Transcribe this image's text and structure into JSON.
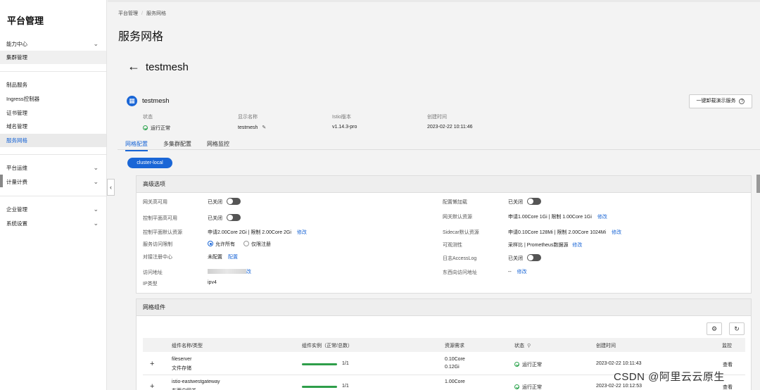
{
  "sidebar": {
    "title": "平台管理",
    "items": [
      {
        "label": "能力中心",
        "expandable": true
      },
      {
        "label": "集群管理",
        "expandable": false
      },
      {
        "label": "制品服务",
        "expandable": false
      },
      {
        "label": "Ingress控制器",
        "expandable": false
      },
      {
        "label": "证书管理",
        "expandable": false
      },
      {
        "label": "域名管理",
        "expandable": false
      },
      {
        "label": "服务网格",
        "expandable": false,
        "active": true
      },
      {
        "label": "平台运维",
        "expandable": true
      },
      {
        "label": "计量计费",
        "expandable": true
      },
      {
        "label": "企业管理",
        "expandable": true
      },
      {
        "label": "系统设置",
        "expandable": true
      }
    ],
    "collapse_icon": "chevron-left-icon"
  },
  "breadcrumb": [
    "平台管理",
    "服务网格"
  ],
  "page_title": "服务网格",
  "mesh": {
    "title": "testmesh",
    "name": "testmesh",
    "uninstall_button": "一键卸载演示服务",
    "info": {
      "status_label": "状态",
      "status_value": "运行正常",
      "display_name_label": "显示名称",
      "display_name_value": "testmesh",
      "istio_label": "Istio版本",
      "istio_value": "v1.14.3-pro",
      "created_label": "创建时间",
      "created_value": "2023-02-22 10:11:46"
    }
  },
  "tabs": [
    "网格配置",
    "多集群配置",
    "网格监控"
  ],
  "cluster_pill": "cluster-local",
  "advanced": {
    "title": "高级选项",
    "left": {
      "gateway_ha_label": "网关高可用",
      "gateway_ha_value": "已关闭",
      "control_ha_label": "控制平面高可用",
      "control_ha_value": "已关闭",
      "control_res_label": "控制平面默认资源",
      "control_res_value": "申请2.00Core 2Gi | 限制 2.00Core 2Gi",
      "access_label": "服务访问限制",
      "access_opt1": "允许所有",
      "access_opt2": "仅限注册",
      "registry_label": "对接注册中心",
      "registry_value": "未配置",
      "registry_link": "配置",
      "address_label": "访问地址",
      "address_link": "改",
      "ip_label": "IP类型",
      "ip_value": "ipv4"
    },
    "right": {
      "lazy_label": "配置懒加载",
      "lazy_value": "已关闭",
      "gw_res_label": "网关默认资源",
      "gw_res_value": "申请1.00Core 1Gi | 限制 1.00Core 1Gi",
      "sidecar_label": "Sidecar默认资源",
      "sidecar_value": "申请0.10Core 128Mi | 限制 2.00Core 1024Mi",
      "obs_label": "可观测性",
      "obs_value": "采样比 | Prometheus数据源",
      "accesslog_label": "日志AccessLog",
      "accesslog_value": "已关闭",
      "ew_label": "东西向访问地址",
      "ew_value": "--"
    },
    "edit_link": "修改"
  },
  "components": {
    "title": "网格组件",
    "columns": [
      "组件名称/类型",
      "组件实例（正常/总数）",
      "资源需求",
      "状态",
      "创建时间",
      "监控"
    ],
    "rows": [
      {
        "name": "fileserver",
        "type": "文件存储",
        "instances": "1/1",
        "progress": 1.0,
        "cpu": "0.10Core",
        "mem": "0.12Gi",
        "status": "运行正常",
        "created": "2023-02-22 10:11:43",
        "action": "查看"
      },
      {
        "name": "istio-eastwestgateway",
        "type": "东西向网关",
        "instances": "1/1",
        "progress": 1.0,
        "cpu": "1.00Core",
        "mem": "",
        "status": "运行正常",
        "created": "2023-02-22 10:12:53",
        "action": "查看"
      }
    ]
  },
  "watermark": "CSDN @阿里云云原生",
  "colors": {
    "accent": "#1a66d6",
    "success": "#2e9e4a"
  }
}
